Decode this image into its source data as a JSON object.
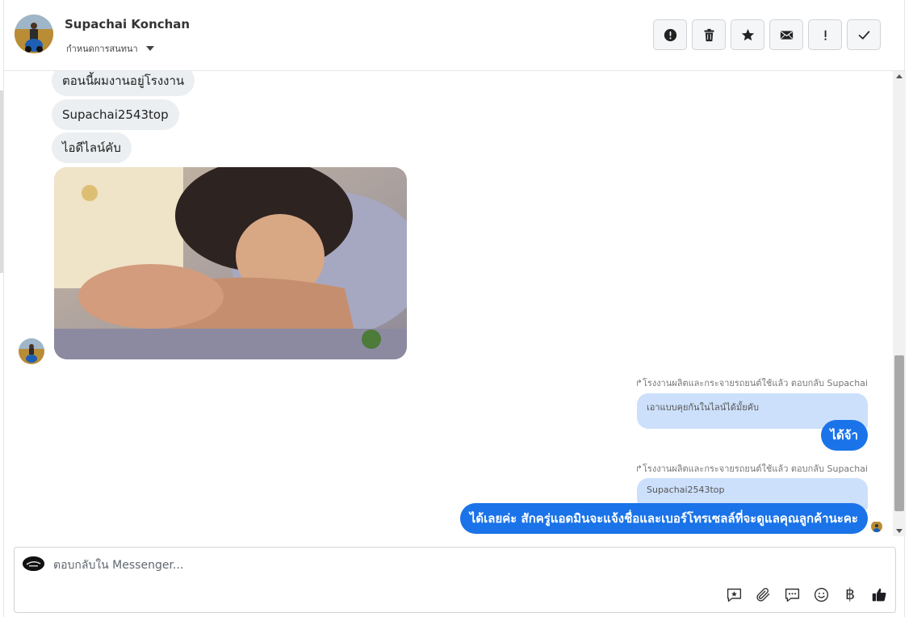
{
  "header": {
    "contact_name": "Supachai Konchan",
    "assign_label": "กำหนดการสนทนา",
    "actions": [
      {
        "name": "mark-spam-button",
        "icon": "alert-circle-icon"
      },
      {
        "name": "delete-button",
        "icon": "trash-icon"
      },
      {
        "name": "star-button",
        "icon": "star-icon"
      },
      {
        "name": "mark-unread-button",
        "icon": "envelope-icon"
      },
      {
        "name": "mark-important-button",
        "icon": "exclamation-icon"
      },
      {
        "name": "mark-done-button",
        "icon": "checkmark-icon"
      }
    ]
  },
  "conversation": {
    "incoming": [
      {
        "text": "ตอนนี้ผมงานอยู่โรงงาน"
      },
      {
        "text": "Supachai2543top"
      },
      {
        "text": "ไอดีไลน์คับ"
      }
    ],
    "replies": [
      {
        "meta": "โรงงานผลิตและกระจายรถยนต์ใช้แล้ว ตอบกลับ Supachai",
        "quoted": "เอาแบบคุยกันในไลน์ได้มั้ยคับ",
        "text": "ได้จ้า"
      },
      {
        "meta": "โรงงานผลิตและกระจายรถยนต์ใช้แล้ว ตอบกลับ Supachai",
        "quoted": "Supachai2543top",
        "text": "ได้เลยค่ะ สักครู่แอดมินจะแจ้งชื่อและเบอร์โทรเซลล์ที่จะดูแลคุณลูกค้านะคะ"
      }
    ]
  },
  "composer": {
    "placeholder": "ตอบกลับใน Messenger...",
    "tools": [
      "saved-reply-icon",
      "paperclip-icon",
      "chat-bubble-icon",
      "emoji-icon",
      "baht-icon",
      "thumbs-up-icon"
    ],
    "baht_symbol": "฿"
  },
  "colors": {
    "outgoing_bubble": "#1a73e8",
    "quoted_bubble": "#cce0fb",
    "incoming_bubble": "#eceff1"
  }
}
